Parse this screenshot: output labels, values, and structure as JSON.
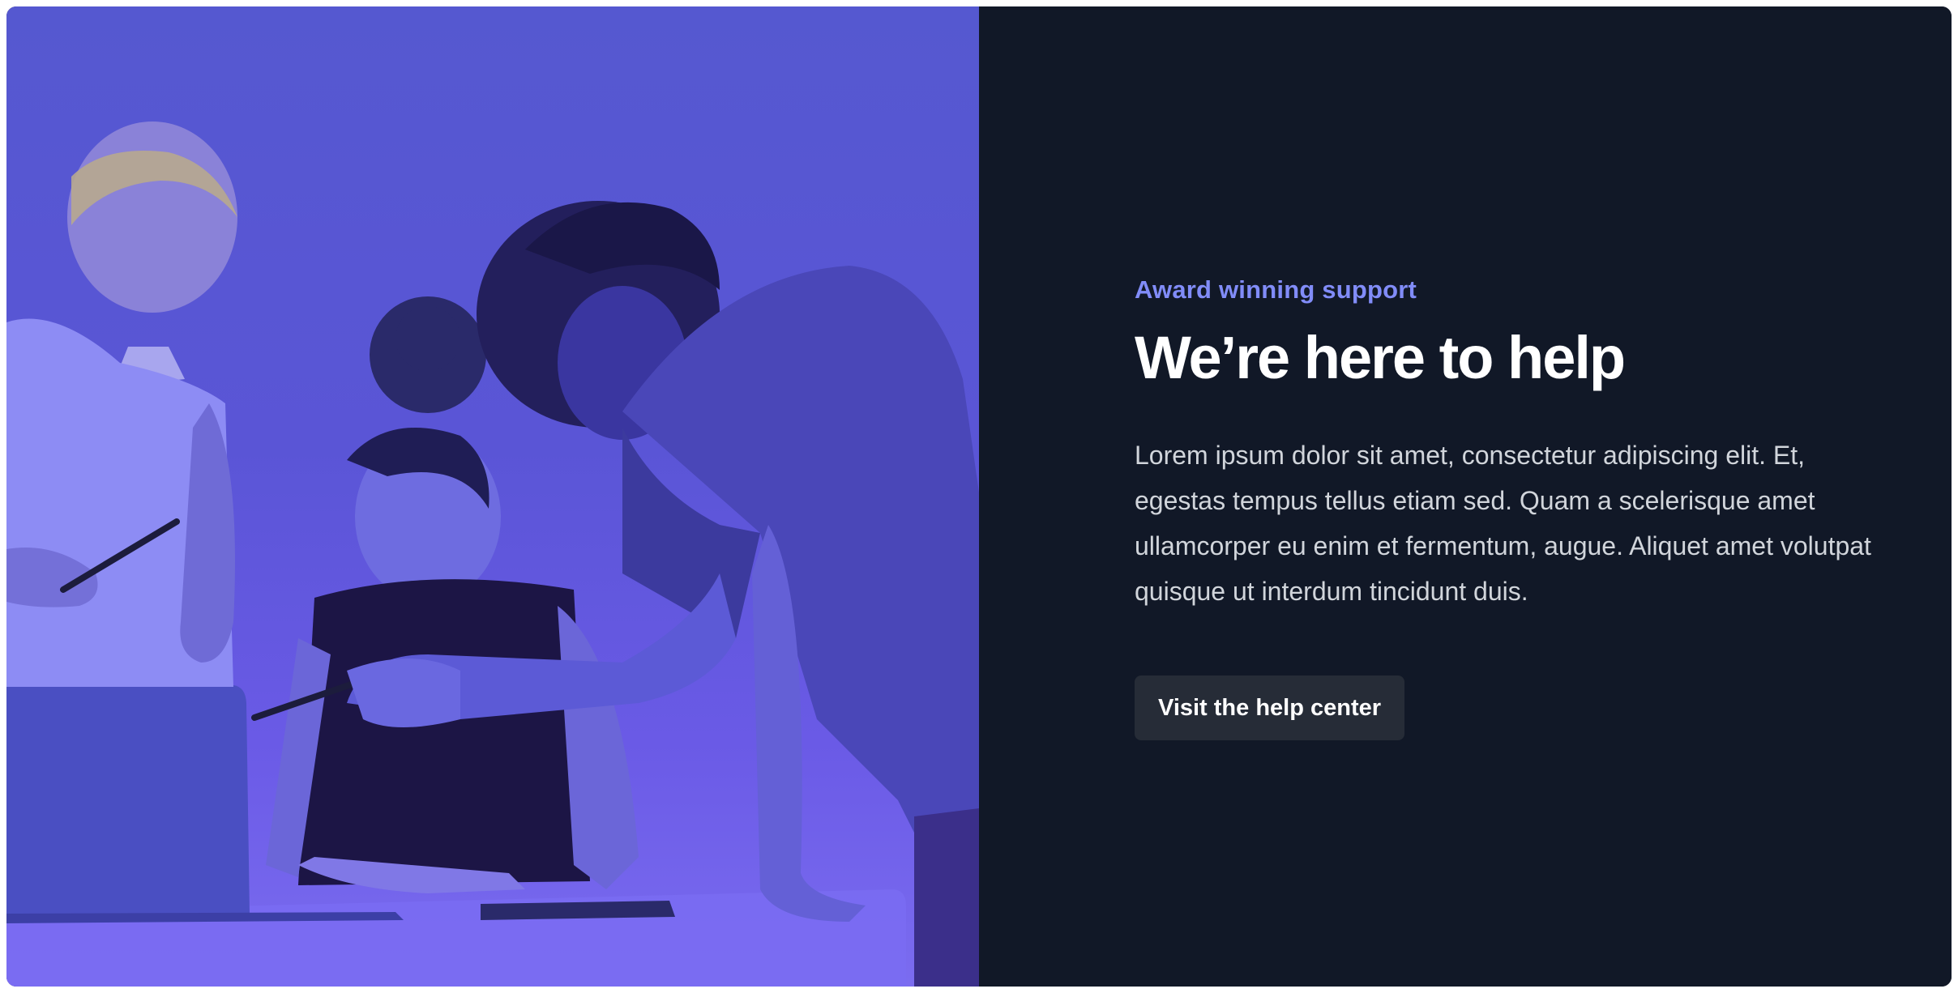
{
  "section": {
    "eyebrow": "Award winning support",
    "title": "We’re here to help",
    "body": "Lorem ipsum dolor sit amet, consectetur adipiscing elit. Et, egestas tempus tellus etiam sed. Quam a scelerisque amet ullamcorper eu enim et fermentum, augue. Aliquet amet volutpat quisque ut interdum tincidunt duis.",
    "cta_label": "Visit the help center"
  },
  "colors": {
    "panel_background": "#111827",
    "accent": "#818cf8",
    "image_tint": "#5558d0",
    "button_background": "#262c37"
  }
}
